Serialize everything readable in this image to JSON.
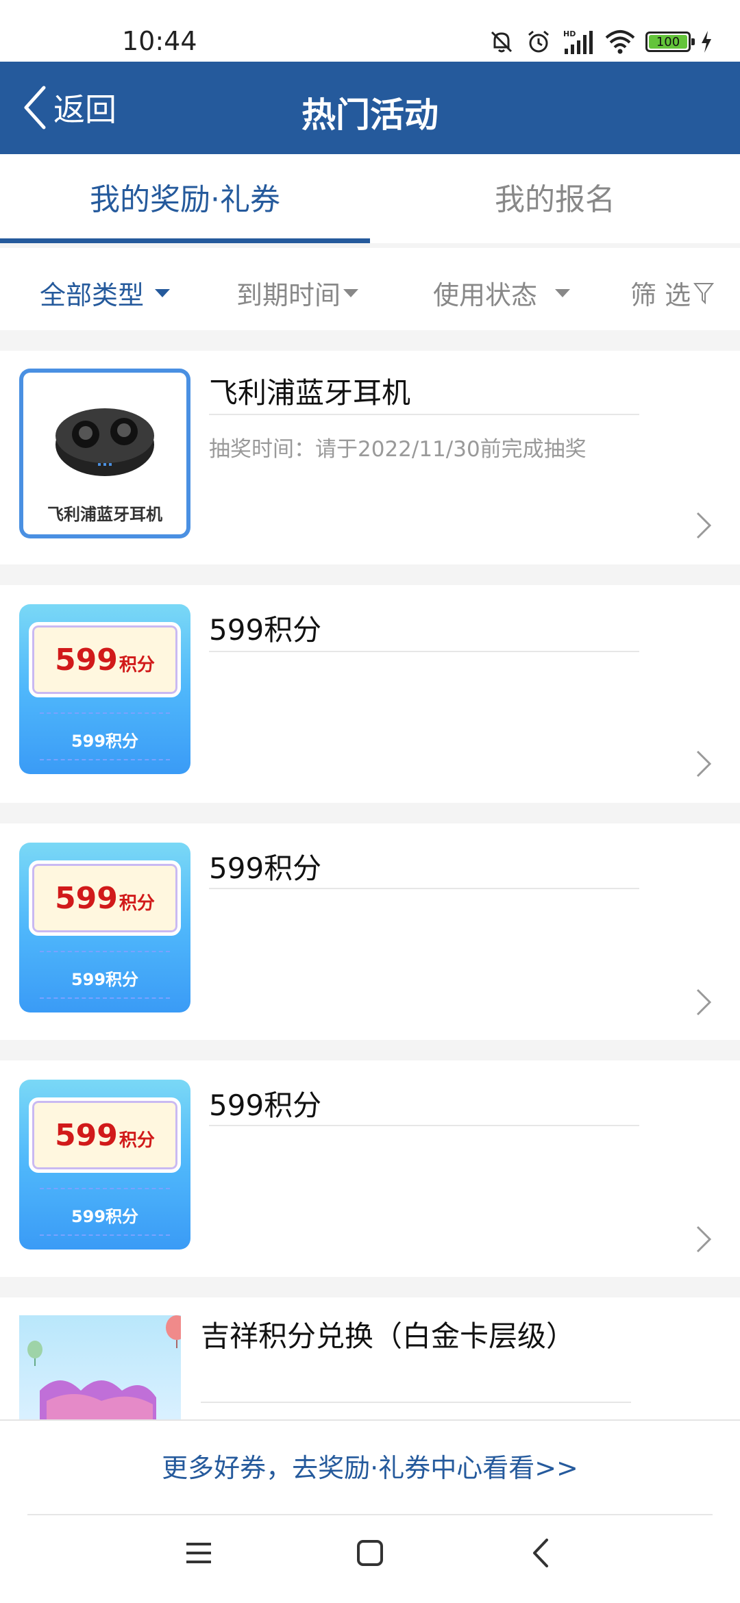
{
  "status_bar": {
    "time": "10:44",
    "network": "HD",
    "battery": "100"
  },
  "header": {
    "back_label": "返回",
    "title": "热门活动"
  },
  "tabs": [
    {
      "label": "我的奖励·礼券",
      "active": true
    },
    {
      "label": "我的报名",
      "active": false
    }
  ],
  "filters": [
    {
      "label": "全部类型",
      "active": true
    },
    {
      "label": "到期时间",
      "active": false
    },
    {
      "label": "使用状态",
      "active": false
    },
    {
      "label": "筛 选",
      "active": false
    }
  ],
  "items": [
    {
      "title": "飞利浦蓝牙耳机",
      "subtitle": "抽奖时间：请于2022/11/30前完成抽奖",
      "thumb_caption": "飞利浦蓝牙耳机"
    },
    {
      "title": "599积分",
      "ticket_value": "599",
      "ticket_unit": "积分",
      "thumb_caption": "599积分"
    },
    {
      "title": "599积分",
      "ticket_value": "599",
      "ticket_unit": "积分",
      "thumb_caption": "599积分"
    },
    {
      "title": "599积分",
      "ticket_value": "599",
      "ticket_unit": "积分",
      "thumb_caption": "599积分"
    },
    {
      "title": "吉祥积分兑换（白金卡层级）"
    }
  ],
  "footer": {
    "more_link": "更多好券，去奖励·礼券中心看看>>"
  },
  "colors": {
    "brand": "#255a9c",
    "accent_red": "#d11a1a",
    "battery_green": "#63c43a"
  }
}
